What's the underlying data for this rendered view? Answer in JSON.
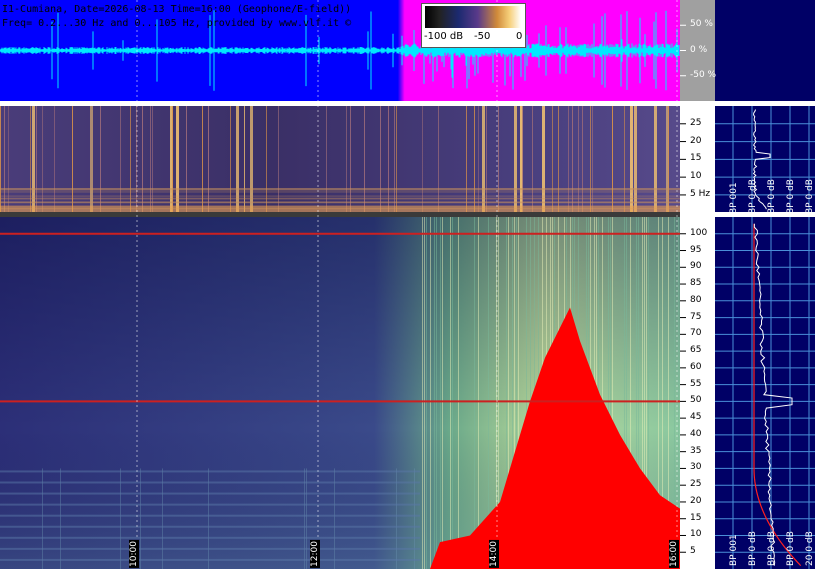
{
  "header": {
    "line1": "I1-Cumiana, Date=2026-08-13 Time=16:00 (Geophone/E-field))",
    "line2": "Freq= 0.2...30 Hz and 0...105 Hz, provided by www.vlf.it ©"
  },
  "colorbar": {
    "ticks": [
      "-100 dB",
      "-50",
      "0"
    ]
  },
  "colors": {
    "waveform_bg_early": "#0000ff",
    "waveform_bg_late": "#ff00ff",
    "waveform_trace": "#00ffff",
    "spectrogram_low_bg": "#3a3d8a",
    "spectrogram_high_bg": "#2a3a80",
    "saturation": "#ff0000",
    "line_marker": "#cc0000",
    "right_panel_bg": "#000066",
    "axis_grid": "#4a8fd8"
  },
  "chart_data": [
    {
      "type": "line",
      "panel": "waveform",
      "y_unit": "%",
      "y_ticks": [
        "50 %",
        "0 %",
        "-50 %"
      ],
      "ylim": [
        -100,
        100
      ]
    },
    {
      "type": "heatmap",
      "panel": "low-frequency-spectrogram",
      "y_unit": "Hz",
      "y_ticks": [
        "25",
        "20",
        "15",
        "10",
        "5 Hz"
      ],
      "ylim": [
        0.2,
        30
      ],
      "spectrum_ticks": [
        "BP 001",
        "BP 0 dB",
        "BP 0 dB",
        "BP 0 dB",
        "BP 0 dB"
      ]
    },
    {
      "type": "heatmap",
      "panel": "high-frequency-spectrogram",
      "y_ticks": [
        "100",
        "95",
        "90",
        "85",
        "80",
        "75",
        "70",
        "65",
        "60",
        "55",
        "50",
        "45",
        "40",
        "35",
        "30",
        "25",
        "20",
        "15",
        "10",
        "5"
      ],
      "ylim": [
        0,
        105
      ],
      "x_ticks": [
        "10:00",
        "12:00",
        "14:00",
        "16:00"
      ],
      "line_at_hz": [
        100,
        50
      ],
      "spectrum_ticks": [
        "BP 001",
        "BP 0 dB",
        "BP 0 dB",
        "BP 0 dB",
        "20 0 dB"
      ]
    }
  ]
}
